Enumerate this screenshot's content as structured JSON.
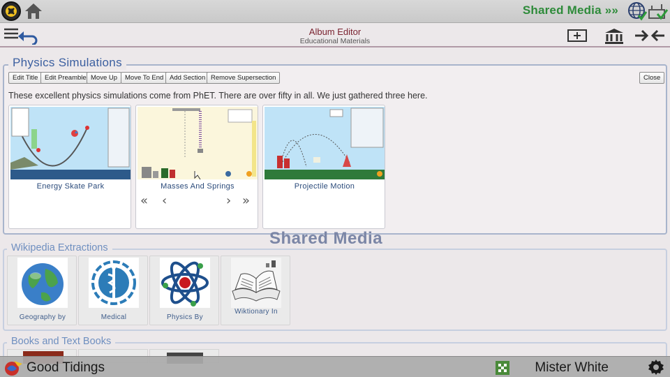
{
  "topbar": {
    "brand": "Shared Media"
  },
  "header": {
    "title": "Album Editor",
    "subtitle": "Educational Materials"
  },
  "physics": {
    "title": "Physics Simulations",
    "toolbar": [
      "Edit Title",
      "Edit Preamble",
      "Move Up",
      "Move To End",
      "Add Section",
      "Remove Supersection"
    ],
    "close_label": "Close",
    "description": "These excellent physics simulations come from PhET.  There are over fifty in all.  We just gathered three here.",
    "cards": [
      {
        "caption": "Energy Skate Park"
      },
      {
        "caption": "Masses And Springs",
        "nav": [
          "«",
          "‹",
          "›",
          "»"
        ]
      },
      {
        "caption": "Projectile Motion"
      }
    ]
  },
  "watermark": "Shared Media",
  "wiki": {
    "title": "Wikipedia Extractions",
    "items": [
      {
        "caption": "Geography by",
        "icon": "earth-globe-icon"
      },
      {
        "caption": "Medical",
        "icon": "medical-caduceus-icon"
      },
      {
        "caption": "Physics By",
        "icon": "atom-icon"
      },
      {
        "caption": "Wiktionary In",
        "icon": "open-book-icon"
      }
    ]
  },
  "books": {
    "title": "Books and Text Books"
  },
  "bottombar": {
    "left_label": "Good Tidings",
    "right_label": "Mister White"
  },
  "colors": {
    "brand_green": "#2e8b3a",
    "title_blue": "#3b5fa0",
    "header_red": "#7a2330"
  }
}
